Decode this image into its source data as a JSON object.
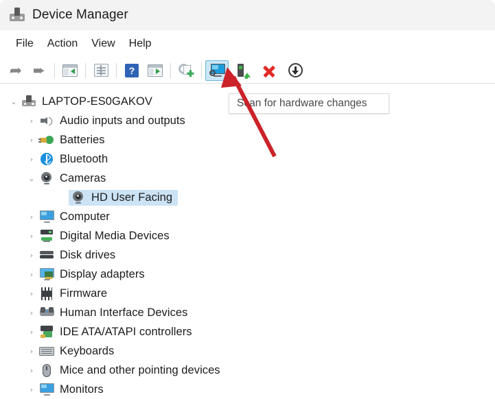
{
  "window": {
    "title": "Device Manager",
    "title_icon": "device-manager-icon"
  },
  "menubar": {
    "items": [
      {
        "label": "File"
      },
      {
        "label": "Action"
      },
      {
        "label": "View"
      },
      {
        "label": "Help"
      }
    ]
  },
  "toolbar": {
    "buttons": [
      {
        "name": "back-button",
        "icon": "left-arrow-icon",
        "label": "Back"
      },
      {
        "name": "forward-button",
        "icon": "right-arrow-icon",
        "label": "Forward"
      },
      {
        "name": "up-one-level-button",
        "icon": "window-left-pane-icon",
        "label": "Up one level"
      },
      {
        "name": "properties-button",
        "icon": "properties-page-icon",
        "label": "Properties"
      },
      {
        "name": "help-button",
        "icon": "help-question-icon",
        "label": "Help"
      },
      {
        "name": "show-hide-console-tree-button",
        "icon": "window-right-pane-icon",
        "label": "Show/Hide console tree"
      },
      {
        "name": "update-driver-software-button",
        "icon": "gear-plus-icon",
        "label": "Update driver software"
      },
      {
        "name": "scan-for-hardware-changes-button",
        "icon": "scan-monitor-icon",
        "label": "Scan for hardware changes"
      },
      {
        "name": "update-driver-button",
        "icon": "device-green-arrow-icon",
        "label": "Update driver"
      },
      {
        "name": "uninstall-device-button",
        "icon": "red-x-icon",
        "label": "Uninstall device"
      },
      {
        "name": "disable-device-button",
        "icon": "circle-down-arrow-icon",
        "label": "Disable device"
      }
    ],
    "active_button": "scan-for-hardware-changes-button"
  },
  "tooltip": {
    "text": "Scan for hardware changes",
    "visible": true
  },
  "tree": {
    "root": {
      "label": "LAPTOP-ES0GAKOV",
      "icon": "computer-icon",
      "expanded": true,
      "level": 0
    },
    "nodes": [
      {
        "label": "Audio inputs and outputs",
        "icon": "speaker-icon",
        "expanded": false,
        "level": 1,
        "selected": false
      },
      {
        "label": "Batteries",
        "icon": "battery-icon",
        "expanded": false,
        "level": 1,
        "selected": false
      },
      {
        "label": "Bluetooth",
        "icon": "bluetooth-icon",
        "expanded": false,
        "level": 1,
        "selected": false
      },
      {
        "label": "Cameras",
        "icon": "camera-icon",
        "expanded": true,
        "level": 1,
        "selected": false
      },
      {
        "label": "HD User Facing",
        "icon": "camera-icon",
        "expanded": null,
        "level": 2,
        "selected": true
      },
      {
        "label": "Computer",
        "icon": "monitor-icon",
        "expanded": false,
        "level": 1,
        "selected": false
      },
      {
        "label": "Digital Media Devices",
        "icon": "digital-media-icon",
        "expanded": false,
        "level": 1,
        "selected": false
      },
      {
        "label": "Disk drives",
        "icon": "disk-drive-icon",
        "expanded": false,
        "level": 1,
        "selected": false
      },
      {
        "label": "Display adapters",
        "icon": "display-adapter-icon",
        "expanded": false,
        "level": 1,
        "selected": false
      },
      {
        "label": "Firmware",
        "icon": "firmware-chip-icon",
        "expanded": false,
        "level": 1,
        "selected": false
      },
      {
        "label": "Human Interface Devices",
        "icon": "human-interface-icon",
        "expanded": false,
        "level": 1,
        "selected": false
      },
      {
        "label": "IDE ATA/ATAPI controllers",
        "icon": "ide-controller-icon",
        "expanded": false,
        "level": 1,
        "selected": false
      },
      {
        "label": "Keyboards",
        "icon": "keyboard-icon",
        "expanded": false,
        "level": 1,
        "selected": false
      },
      {
        "label": "Mice and other pointing devices",
        "icon": "mouse-icon",
        "expanded": false,
        "level": 1,
        "selected": false
      },
      {
        "label": "Monitors",
        "icon": "monitor-icon",
        "expanded": false,
        "level": 1,
        "selected": false
      }
    ],
    "chevron_expanded": "⌄",
    "chevron_collapsed": "›"
  },
  "annotation": {
    "arrow_color": "#cc2229",
    "points_to": "scan-for-hardware-changes-button"
  },
  "colors": {
    "titlebar_bg": "#f3f3f3",
    "selection_bg": "#cce3f5",
    "toolbar_active_bg": "#cce8f6",
    "accent_blue": "#1a9bdc"
  }
}
